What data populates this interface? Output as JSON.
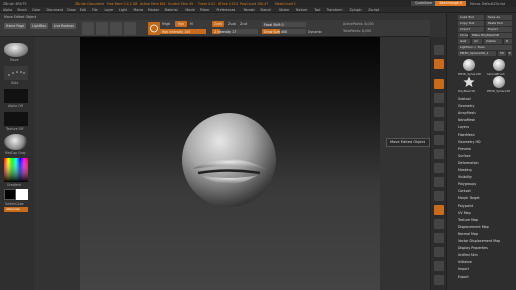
{
  "titlebar": {
    "app": "ZBrush 4R6 P2",
    "items": [
      "ZBrush Document",
      "Free Mem 3.4,2 GB",
      "Active Mem 601",
      "Scratch Disk 49",
      "Timer 0.01",
      "ATime 0.014",
      "PolyCount 190.47",
      "MeshCount 1"
    ],
    "quicksave": "QuickSave",
    "seethrough": "See-through 0",
    "menus_label": "Menus",
    "script_label": "DefaultZScript"
  },
  "menubar": [
    "Alpha",
    "Brush",
    "Color",
    "Document",
    "Draw",
    "Edit",
    "File",
    "Layer",
    "Light",
    "Macro",
    "Marker",
    "Material",
    "Movie",
    "Picker",
    "Preferences",
    "Render",
    "Stencil",
    "Stroke",
    "Texture",
    "Tool",
    "Transform",
    "Zplugin",
    "Zscript"
  ],
  "status": "Move Edited Object",
  "toolbar": {
    "home_page": "Home Page",
    "lightbox": "LightBox",
    "live_boolean": "Live Boolean",
    "mrgb": "Mrgb",
    "rgb": "Rgb",
    "m": "M",
    "rgb_intensity": "Rgb Intensity 100",
    "zadd": "Zadd",
    "zsub": "Zsub",
    "zcut": "Zcut",
    "z_intensity": "Z Intensity 17",
    "focal_shift": "Focal Shift 0",
    "draw_size": "Draw Size 400",
    "dynamic": "Dynamic",
    "active_points": "ActivePoints: 8,000",
    "total_points": "TotalPoints: 8,000",
    "z_intensity_value": 0.17,
    "rgb_intensity_value": 1.0,
    "draw_size_fraction": 0.4
  },
  "left_shelf": {
    "brush": "Move",
    "stroke": "Dots",
    "alpha": "Alpha Off",
    "texture": "Texture Off",
    "material": "MatCap Gray",
    "gradient": "Gradient",
    "switch_color": "SwitchColor",
    "alternate": "Alternate"
  },
  "tooltip": "Move Edited Object",
  "tray": {
    "buttons": [
      [
        "Load Tool",
        "Save As"
      ],
      [
        "Copy Tool",
        "Paste Tool"
      ],
      [
        "Import",
        "Export"
      ],
      [
        "Clone",
        "Make PolyMesh3D"
      ],
      [
        "GoZ",
        "All",
        "Visible",
        "R"
      ]
    ],
    "lightbox_tools": "Lightbox > Tools",
    "tool_name": "PM3D_Sphere3D_1",
    "tool_count": "50",
    "thumbs": [
      "PM3D_Sphere3D",
      "SimpleBrush",
      "PolyMesh3D",
      "PM3D_Sphere3D"
    ],
    "r_label": "R",
    "menus": [
      "Subtool",
      "Geometry",
      "ArrayMesh",
      "NanoMesh",
      "Layers",
      "FiberMesh",
      "Geometry HD",
      "Preview",
      "Surface",
      "Deformation",
      "Masking",
      "Visibility",
      "Polygroups",
      "Contact",
      "Morph Target",
      "Polypaint",
      "UV Map",
      "Texture Map",
      "Displacement Map",
      "Normal Map",
      "Vector Displacement Map",
      "Display Properties",
      "Unified Skin",
      "Initialize",
      "Import",
      "Export"
    ]
  },
  "colors": {
    "accent": "#e0801c",
    "primary_color": "#000000",
    "secondary_color": "#ffffff"
  },
  "icons": [
    "sphere-icon",
    "palette-icon",
    "color-picker-icon",
    "frame-icon",
    "move-icon",
    "scale-icon",
    "rotate-icon",
    "lock-icon"
  ]
}
